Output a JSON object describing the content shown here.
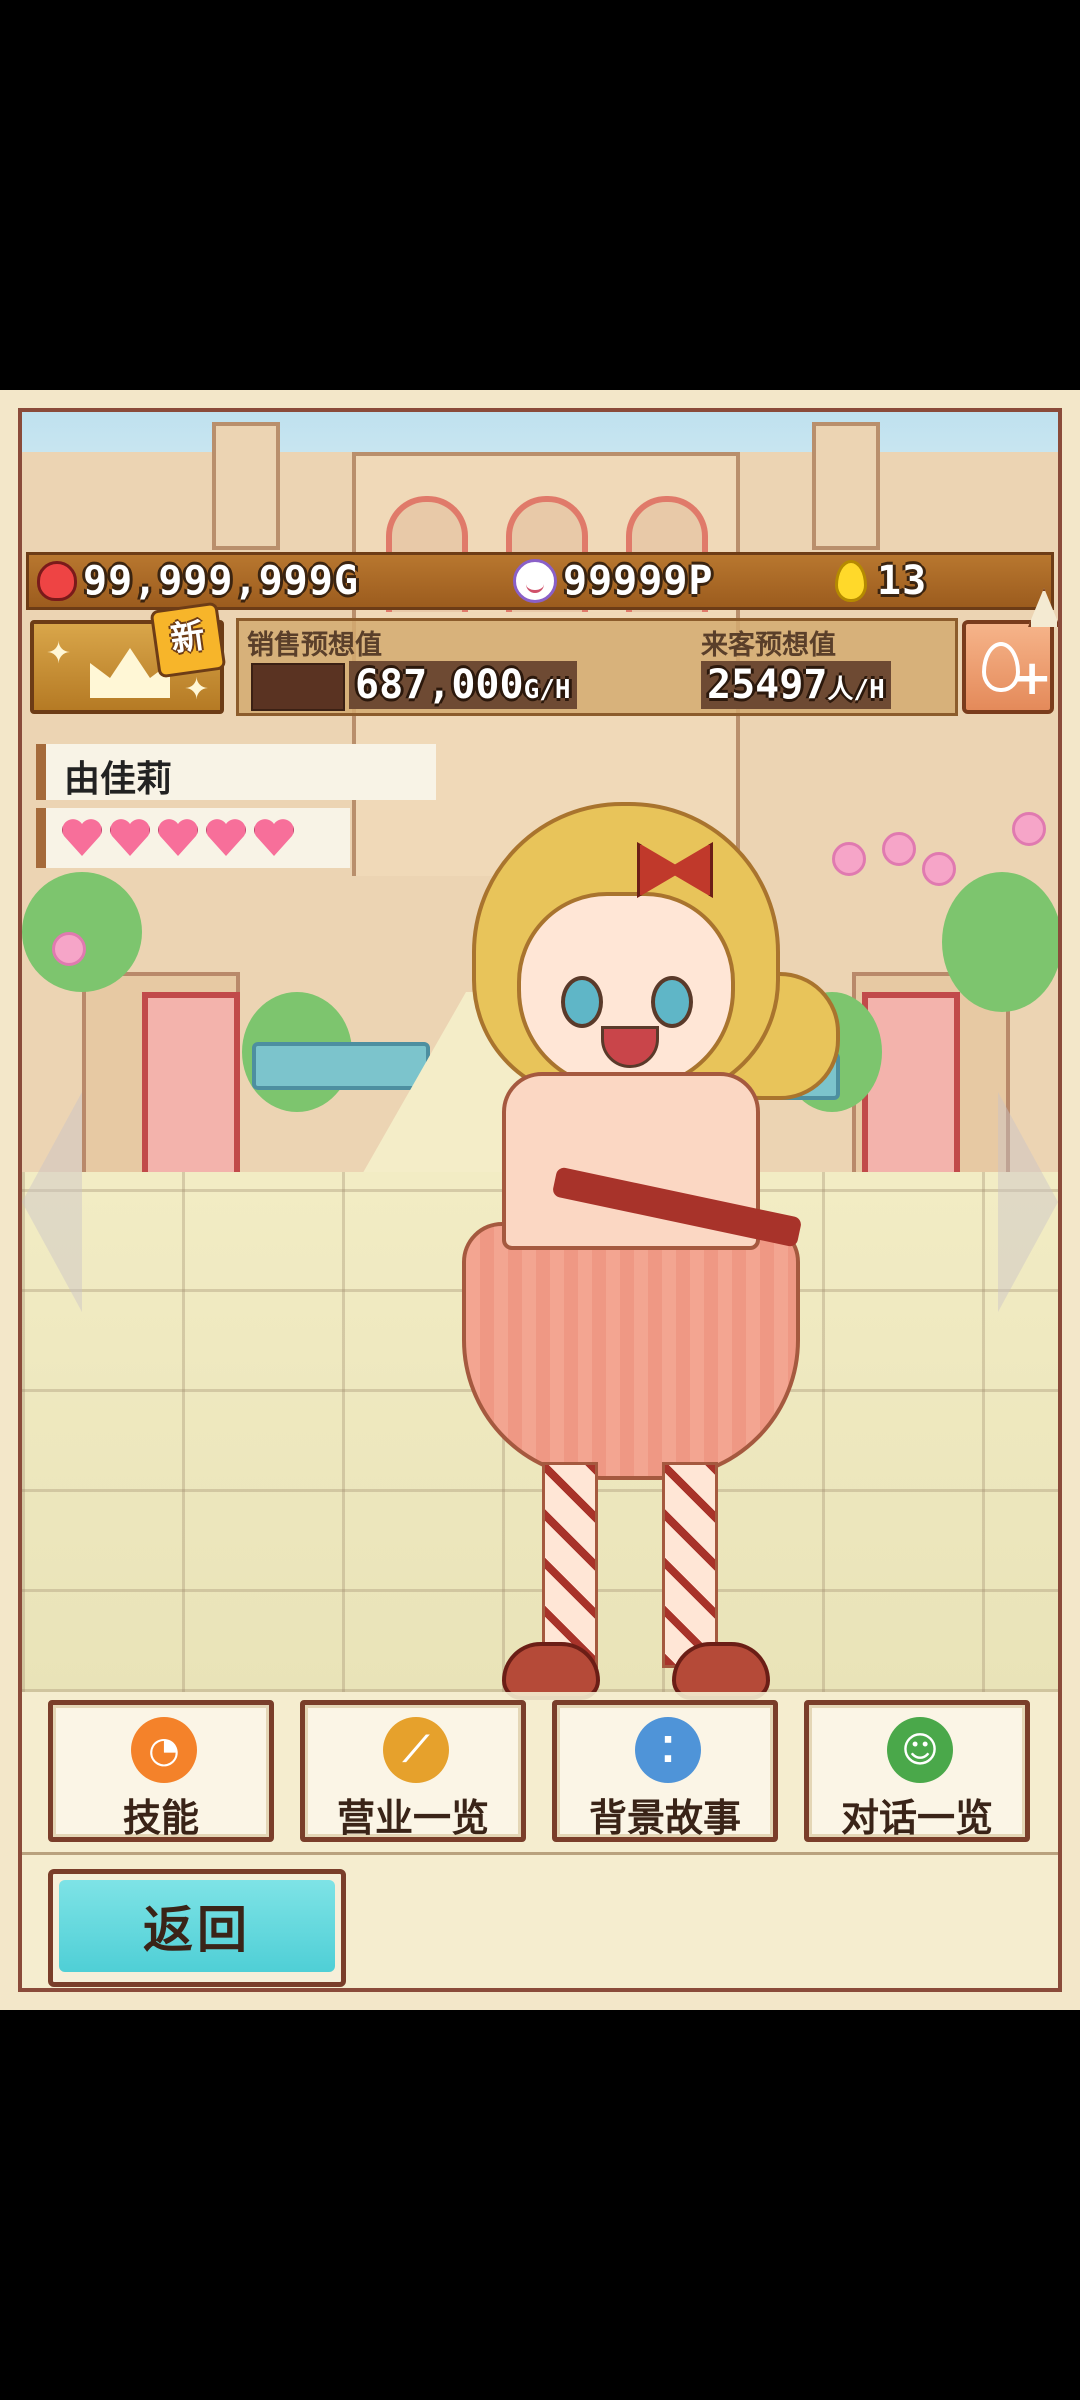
{
  "hud": {
    "gold": "99,999,999G",
    "points": "99999P",
    "eggs": "13"
  },
  "crown_button": {
    "badge": "新"
  },
  "stats": {
    "sales_label": "销售预想值",
    "customer_label": "来客预想值",
    "sales_value": "687,000",
    "sales_unit": "G/H",
    "customer_value": "25497",
    "customer_unit": "人/H"
  },
  "character": {
    "name": "由佳莉",
    "hearts": 5,
    "hearts_max": 5
  },
  "menu": {
    "skill": "技能",
    "business": "营业一览",
    "story": "背景故事",
    "dialogue": "对话一览"
  },
  "back_label": "返回",
  "colors": {
    "frame": "#8a4b3a",
    "back_button": "#5fd8de",
    "hud": "#a8682a",
    "heart": "#f76f9a"
  },
  "icons": {
    "gold": "wallet-icon",
    "points": "smile-icon",
    "eggs": "egg-icon",
    "crown": "crown-icon",
    "egg_plus": "egg-plus-icon",
    "skill": "skill-icon",
    "business": "broom-icon",
    "story": "footprints-icon",
    "dialogue": "chat-face-icon"
  }
}
